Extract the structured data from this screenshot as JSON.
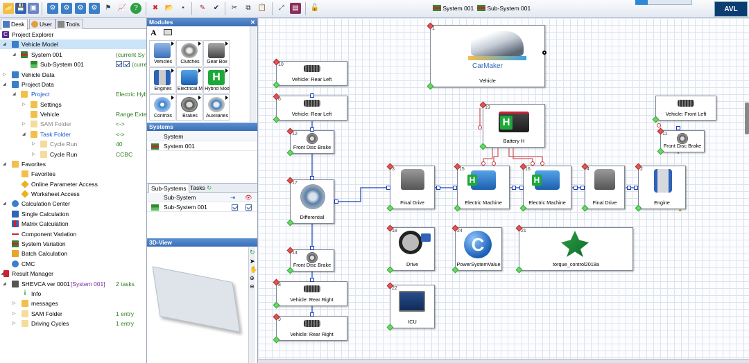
{
  "toolbar": {
    "title_system": "System 001",
    "title_subsystem": "Sub-System 001",
    "brand": "AVL"
  },
  "left": {
    "tabs": [
      "Desk",
      "User",
      "Tools"
    ],
    "tree": [
      {
        "label": "Project Explorer"
      },
      {
        "label": "Vehicle Model"
      },
      {
        "label": "System 001",
        "value": "(current Sy"
      },
      {
        "label": "Sub-System 001",
        "value": "(curre"
      },
      {
        "label": "Vehicle Data"
      },
      {
        "label": "Project Data"
      },
      {
        "label": "Project",
        "value": "Electric Hyb"
      },
      {
        "label": "Settings"
      },
      {
        "label": "Vehicle",
        "value": "Range Exte"
      },
      {
        "label": "SAM Folder",
        "value": "<->"
      },
      {
        "label": "Task Folder",
        "value": "<->"
      },
      {
        "label": "Cycle Run",
        "value": "40"
      },
      {
        "label": "Cycle Run",
        "value": "CCBC"
      },
      {
        "label": "Favorites"
      },
      {
        "label": "Favorites"
      },
      {
        "label": "Online Parameter Access"
      },
      {
        "label": "Worksheet Access"
      },
      {
        "label": "Calculation Center"
      },
      {
        "label": "Single Calculation"
      },
      {
        "label": "Matrix Calculation"
      },
      {
        "label": "Component Variation"
      },
      {
        "label": "System Variation"
      },
      {
        "label": "Batch Calculation"
      },
      {
        "label": "CMC"
      },
      {
        "label": "Result Manager"
      },
      {
        "label": "SHEVCA ver 0001",
        "label2": "[System 001]",
        "value": "2 tasks"
      },
      {
        "label": "Info"
      },
      {
        "label": "messages"
      },
      {
        "label": "SAM Folder",
        "value": "1 entry"
      },
      {
        "label": "Driving Cycles",
        "value": "1 entry"
      }
    ]
  },
  "modules": {
    "header": "Modules",
    "text_tool": "A",
    "items": [
      "Vehicles",
      "Clutches",
      "Gear Box",
      "Engines",
      "Electrical M",
      "Hybrid Mod",
      "Controls",
      "Brakes",
      "Auxiliaries"
    ]
  },
  "systems": {
    "header": "Systems",
    "column": "System",
    "rows": [
      "System 001"
    ]
  },
  "subsystems": {
    "tab1": "Sub-Systems",
    "tab2": "Tasks",
    "column": "Sub-System",
    "rows": [
      "Sub-System 001"
    ]
  },
  "view3d": {
    "header": "3D-View"
  },
  "canvas": {
    "blocks": [
      {
        "num": "1",
        "label": "Vehicle",
        "logo": "CarMaker"
      },
      {
        "num": "10",
        "label": "Vehicle: Rear Left"
      },
      {
        "num": "6",
        "label": "Vehicle: Rear Left"
      },
      {
        "num": "12",
        "label": "Front Disc Brake"
      },
      {
        "num": "17",
        "label": "Differential"
      },
      {
        "num": "14",
        "label": "Front Disc Brake"
      },
      {
        "num": "8",
        "label": "Vehicle: Rear Right"
      },
      {
        "num": "9",
        "label": "Vehicle: Rear Right"
      },
      {
        "num": "3",
        "label": "Final Drive"
      },
      {
        "num": "15",
        "label": "Electric Machine"
      },
      {
        "num": "16",
        "label": "Electric Machine"
      },
      {
        "num": "4",
        "label": "Final Drive"
      },
      {
        "num": "2",
        "label": "Engine"
      },
      {
        "num": "19",
        "label": "Battery H"
      },
      {
        "num": "",
        "label": "Vehicle: Front Left"
      },
      {
        "num": "11",
        "label": "Front Disc Brake"
      },
      {
        "num": "18",
        "label": "Drive"
      },
      {
        "num": "24",
        "label": "PowerSystemValue"
      },
      {
        "num": "21",
        "label": "torque_control2018a"
      },
      {
        "num": "22",
        "label": "ICU"
      }
    ]
  },
  "colors": {
    "panel_header": "#3a6fb8",
    "connection_blue": "#1c3fb0",
    "connection_red": "#c83232",
    "hybrid_green": "#1fa83a"
  }
}
